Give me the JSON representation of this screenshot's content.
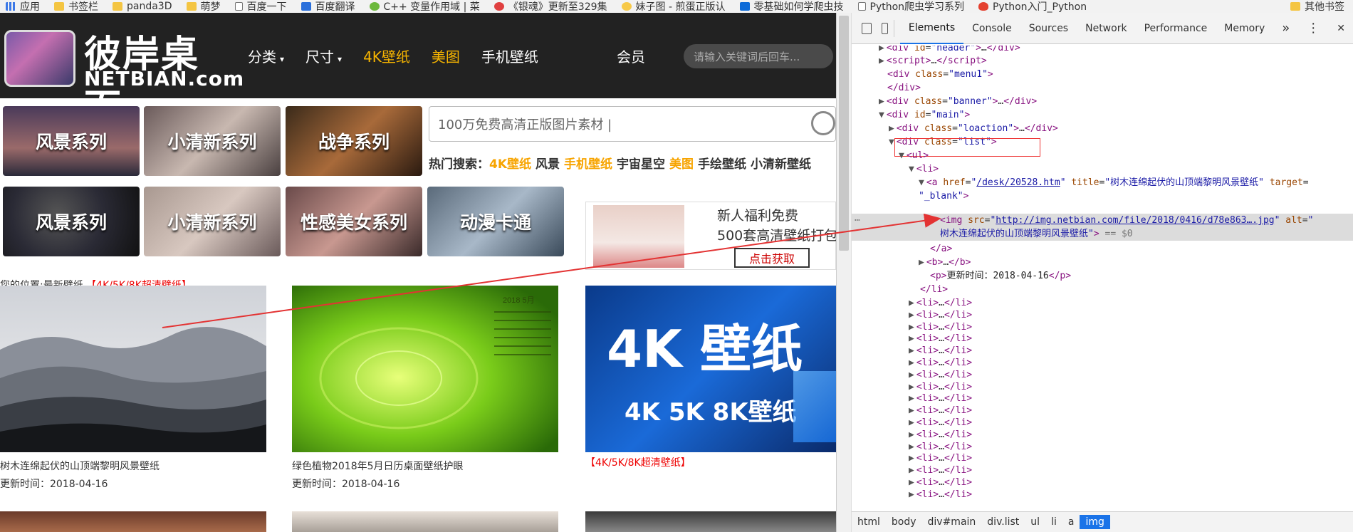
{
  "bookmarks": [
    {
      "label": "应用",
      "icon": "apps-icon"
    },
    {
      "label": "书签栏",
      "icon": "folder-icon"
    },
    {
      "label": "panda3D",
      "icon": "folder-icon"
    },
    {
      "label": "萌梦",
      "icon": "folder-icon"
    },
    {
      "label": "百度一下",
      "icon": "page-icon"
    },
    {
      "label": "百度翻译",
      "icon": "translate-icon"
    },
    {
      "label": "C++ 变量作用域 | 菜",
      "icon": "site-icon"
    },
    {
      "label": "《银魂》更新至329集",
      "icon": "video-icon"
    },
    {
      "label": "妹子图 - 煎蛋正版认",
      "icon": "egg-icon"
    },
    {
      "label": "零基础如何学爬虫技",
      "icon": "zhihu-icon"
    },
    {
      "label": "Python爬虫学习系列",
      "icon": "page-icon"
    },
    {
      "label": "Python入门_Python",
      "icon": "flame-icon"
    },
    {
      "label": "其他书签",
      "icon": "folder-icon"
    }
  ],
  "site": {
    "logo": {
      "cn": "彼岸桌面",
      "en": "NETBIAN.com"
    },
    "nav": [
      {
        "label": "分类",
        "caret": "▾",
        "highlight": false
      },
      {
        "label": "尺寸",
        "caret": "▾",
        "highlight": false
      },
      {
        "label": "4K壁纸",
        "caret": "",
        "highlight": true
      },
      {
        "label": "美图",
        "caret": "",
        "highlight": true
      },
      {
        "label": "手机壁纸",
        "caret": "",
        "highlight": false
      }
    ],
    "member": "会员",
    "search_placeholder": "请输入关键词后回车...",
    "cards_row1": [
      "风景系列",
      "小清新系列",
      "战争系列"
    ],
    "cards_row2": [
      "风景系列",
      "小清新系列",
      "性感美女系列",
      "动漫卡通"
    ],
    "big_search": "100万免费高清正版图片素材 |",
    "hot_label": "热门搜索：",
    "hot_items": [
      {
        "label": "4K壁纸",
        "hl": true
      },
      {
        "label": "风景",
        "hl": false
      },
      {
        "label": "手机壁纸",
        "hl": true
      },
      {
        "label": "宇宙星空",
        "hl": false
      },
      {
        "label": "美图",
        "hl": true
      },
      {
        "label": "手绘壁纸",
        "hl": false
      },
      {
        "label": "小清新壁纸",
        "hl": false
      }
    ],
    "promo": {
      "line1": "新人福利免费",
      "line2": "500套高清壁纸打包",
      "button": "点击获取"
    },
    "breadcrumb": {
      "prefix": "您的位置:最新壁纸",
      "link": "【4K/5K/8K超清壁纸】"
    },
    "tiles": [
      {
        "title": "树木连绵起伏的山顶端黎明风景壁纸",
        "date": "更新时间：2018-04-16"
      },
      {
        "title": "绿色植物2018年5月日历桌面壁纸护眼",
        "date": "更新时间：2018-04-16"
      },
      {
        "title": "【4K/5K/8K超清壁纸】",
        "date": ""
      }
    ],
    "tile3_big": "4K 壁纸",
    "tile3_small": "4K 5K 8K壁纸",
    "calendar_label": "2018 5月"
  },
  "devtools": {
    "tabs": [
      "Elements",
      "Console",
      "Sources",
      "Network",
      "Performance",
      "Memory"
    ],
    "more_tabs": "»",
    "menu": "⋮",
    "close": "✕",
    "lines": {
      "header_id": "header",
      "script_ellipsis": "…",
      "menu1": "menu1",
      "banner": "banner",
      "main": "main",
      "loaction": "loaction",
      "list": "list",
      "href": "/desk/20528.htm",
      "title_val": "树木连绵起伏的山顶端黎明风景壁纸",
      "target_val": "_blank",
      "img_src": "http://img.netbian.com/file/2018/0416/d78e863….jpg",
      "img_alt": "树木连绵起伏的山顶端黎明风景壁纸",
      "eq0": "== $0",
      "update_text": "更新时间：2018-04-16"
    },
    "li_collapsed_count": 17,
    "breadcrumbs": [
      "html",
      "body",
      "div#main",
      "div.list",
      "ul",
      "li",
      "a",
      "img"
    ],
    "selected_crumb": "img"
  },
  "colors": {
    "accent_orange": "#f7b500",
    "devtools_blue": "#1a73e8",
    "annotation_red": "#e33333"
  }
}
